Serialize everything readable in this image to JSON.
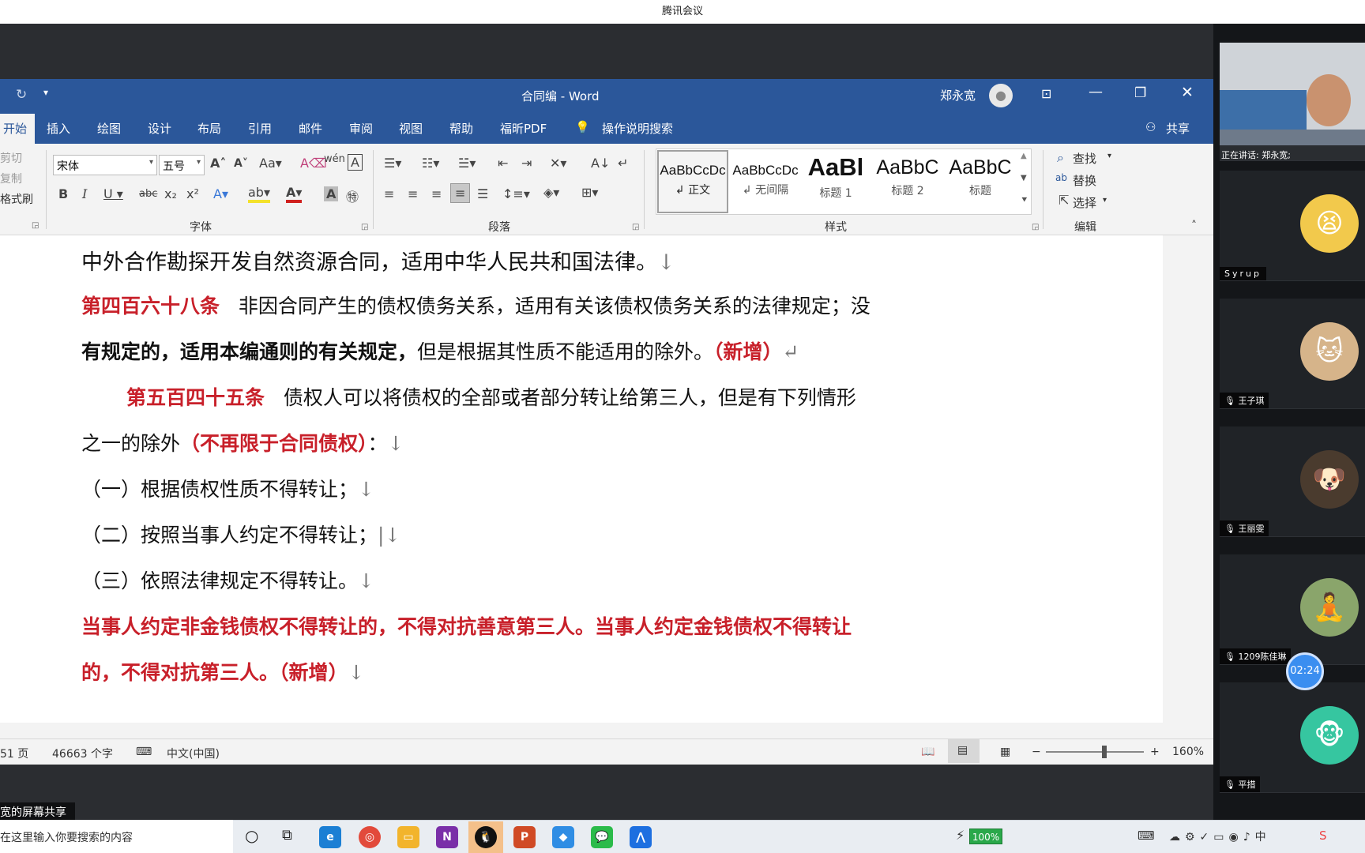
{
  "meeting": {
    "title": "腾讯会议",
    "share_label": "宽的屏幕共享",
    "timer": "02:24",
    "speaking": "正在讲话: 郑永宽;"
  },
  "word": {
    "doc_title": "合同编  -  Word",
    "user_name": "郑永宽",
    "tabs": [
      "开始",
      "插入",
      "绘图",
      "设计",
      "布局",
      "引用",
      "邮件",
      "审阅",
      "视图",
      "帮助",
      "福昕PDF",
      "操作说明搜索"
    ],
    "share_label": "共享",
    "ribbon": {
      "clipboard": [
        "剪切",
        "复制",
        "格式刷"
      ],
      "font_name": "宋体",
      "font_size": "五号",
      "font_group": "字体",
      "paragraph_group": "段落",
      "styles_group": "样式",
      "editing_group": "编辑",
      "styles": [
        {
          "sample": "AaBbCcDc",
          "name": "↲ 正文"
        },
        {
          "sample": "AaBbCcDc",
          "name": "↲ 无间隔"
        },
        {
          "sample": "AaBl",
          "name": "标题 1"
        },
        {
          "sample": "AaBbC",
          "name": "标题 2"
        },
        {
          "sample": "AaBbC",
          "name": "标题"
        }
      ],
      "editing": [
        "查找",
        "替换",
        "选择"
      ]
    },
    "document": {
      "l1": "中外合作勘探开发自然资源合同，适用中华人民共和国法律。",
      "l2_red": "第四百六十八条",
      "l2_text": "非因合同产生的债权债务关系，适用有关该债权债务关系的法律规定；没",
      "l3_bold": "有规定的，适用本编通则的有关规定，",
      "l3_text": "但是根据其性质不能适用的除外。",
      "l3_red": "（新增）",
      "l4_red": "第五百四十五条",
      "l4_text": "债权人可以将债权的全部或者部分转让给第三人，但是有下列情形",
      "l5_text": "之一的除外",
      "l5_red": "（不再限于合同债权）",
      "l5_tail": "：",
      "l6": "（一）根据债权性质不得转让；",
      "l7": "（二）按照当事人约定不得转让；",
      "l8": "（三）依照法律规定不得转让。",
      "l9_red": "当事人约定非金钱债权不得转让的，不得对抗善意第三人。当事人约定金钱债权不得转让",
      "l10_red": "的，不得对抗第三人。（新增）"
    },
    "status": {
      "pages": "51 页",
      "words": "46663 个字",
      "language": "中文(中国)",
      "zoom": "160%",
      "zoom_level": 0.6
    }
  },
  "participants": [
    {
      "name": "Syrup",
      "color": "#f2c94c"
    },
    {
      "name": "王子琪",
      "color": "#d6b48a"
    },
    {
      "name": "王丽雯",
      "color": "#4a3b2e"
    },
    {
      "name": "1209陈佳琳",
      "color": "#8aa56b"
    },
    {
      "name": "平措",
      "color": "#36c6a0"
    }
  ],
  "taskbar": {
    "search_placeholder": "在这里输入你要搜索的内容",
    "battery": "100%"
  }
}
